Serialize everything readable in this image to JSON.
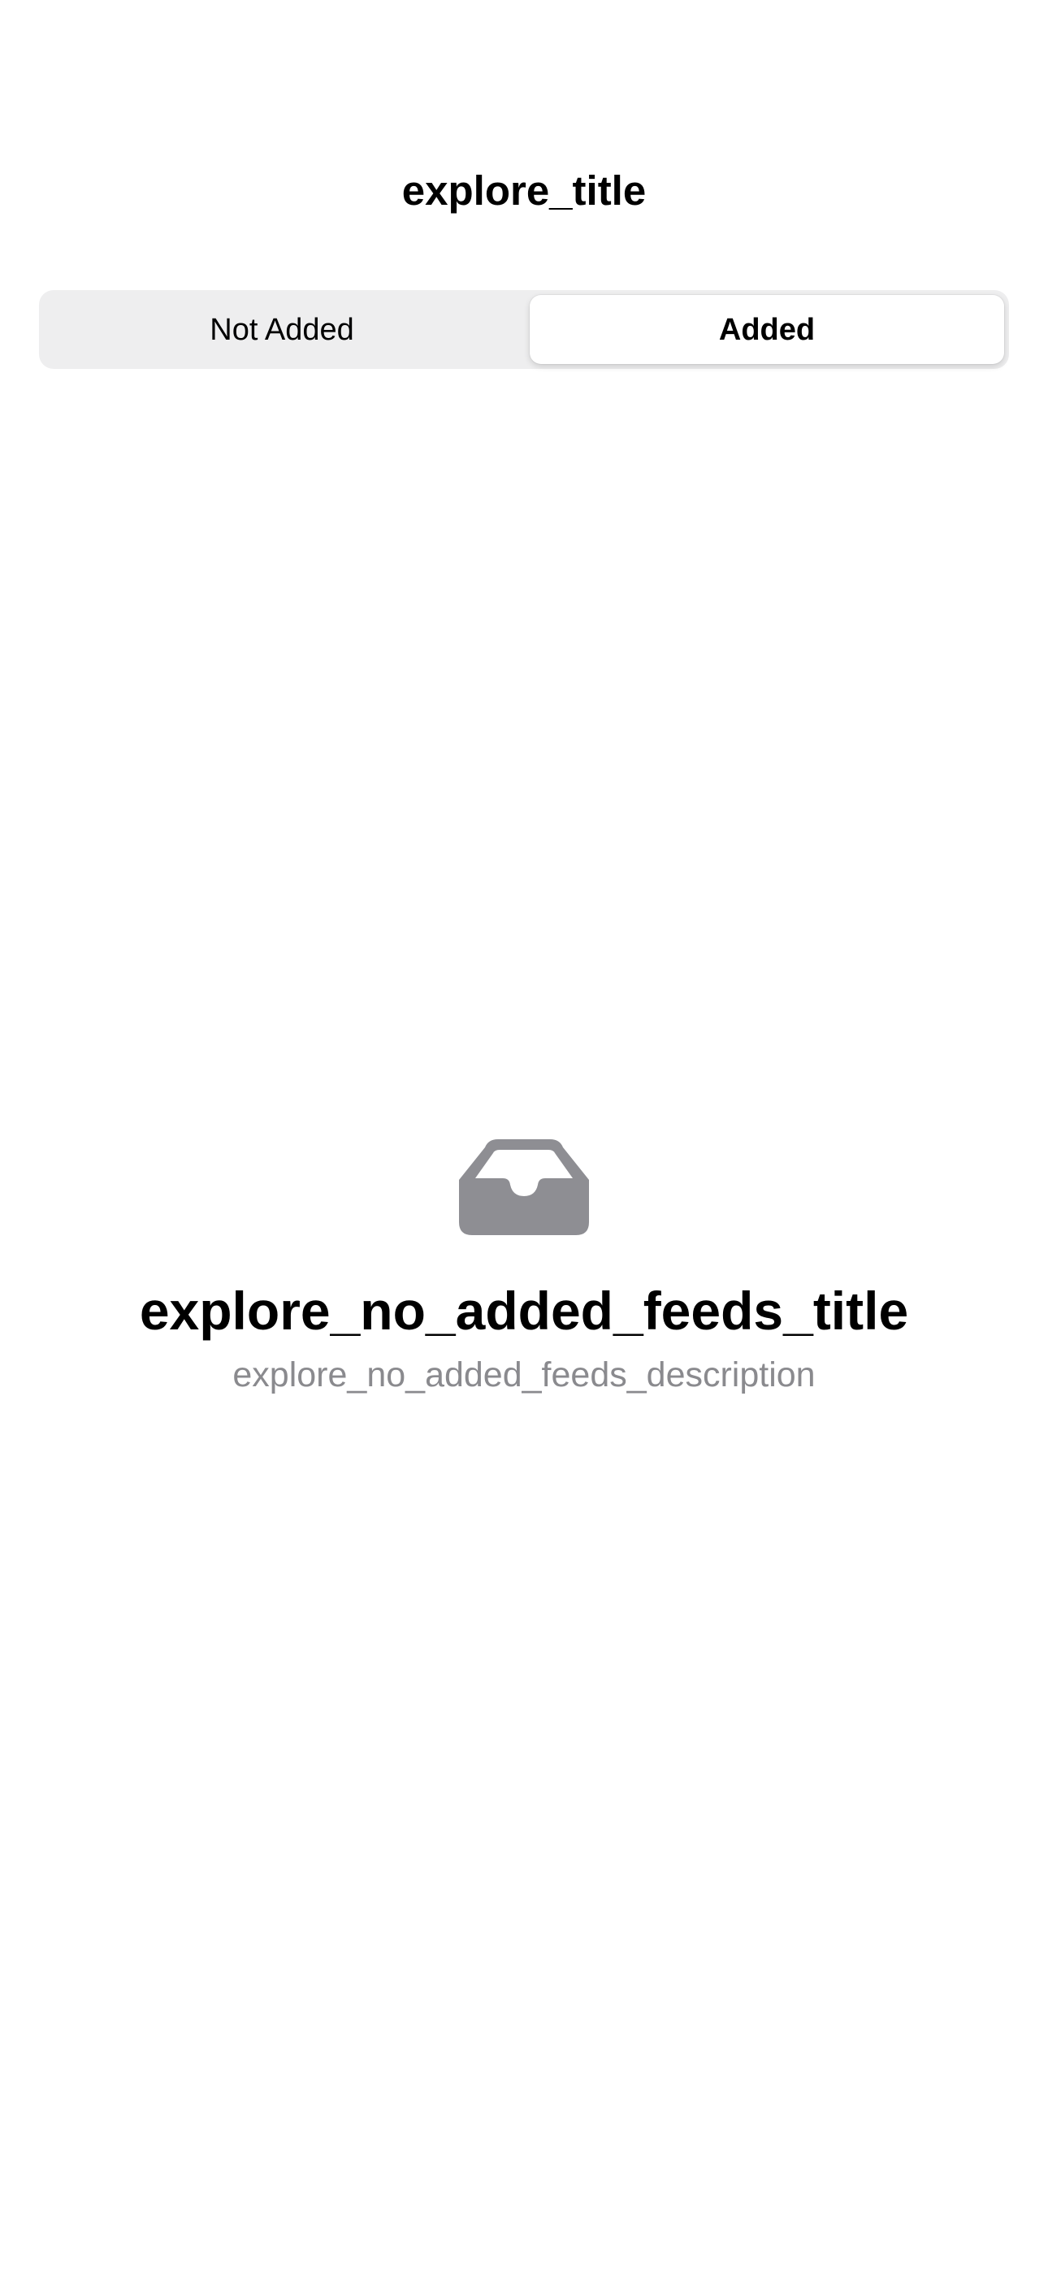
{
  "nav": {
    "title": "explore_title"
  },
  "segmented_control": {
    "segments": [
      {
        "label": "Not Added",
        "selected": false
      },
      {
        "label": "Added",
        "selected": true
      }
    ]
  },
  "empty_state": {
    "icon": "inbox-tray-icon",
    "title": "explore_no_added_feeds_title",
    "description": "explore_no_added_feeds_description",
    "icon_color": "#8e8e93"
  }
}
